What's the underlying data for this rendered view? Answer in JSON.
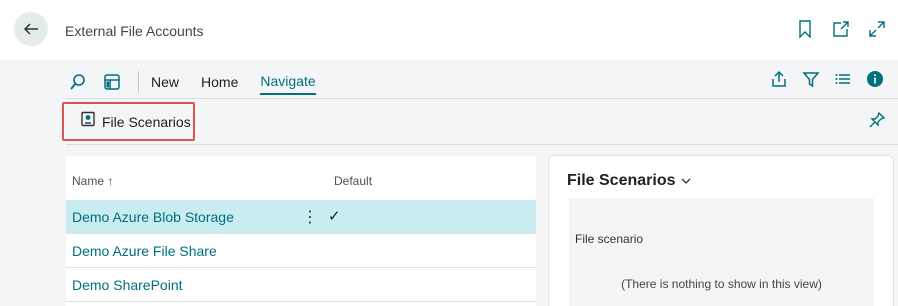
{
  "header": {
    "title": "External File Accounts"
  },
  "actionbar": {
    "tabs": [
      {
        "label": "New"
      },
      {
        "label": "Home"
      },
      {
        "label": "Navigate"
      }
    ]
  },
  "subaction": {
    "label": "File Scenarios"
  },
  "list": {
    "columns": {
      "name": "Name ↑",
      "default": "Default"
    },
    "rows": [
      {
        "name": "Demo Azure Blob Storage",
        "menu": "⋮",
        "default": "✓"
      },
      {
        "name": "Demo Azure File Share",
        "default": ""
      },
      {
        "name": "Demo SharePoint",
        "default": ""
      }
    ]
  },
  "factbox": {
    "title": "File Scenarios",
    "column": "File scenario",
    "empty": "(There is nothing to show in this view)"
  },
  "colors": {
    "accent": "#00707c",
    "selected_row": "#c8ecef",
    "highlight_border": "#d9534f",
    "info": "#00707c"
  }
}
